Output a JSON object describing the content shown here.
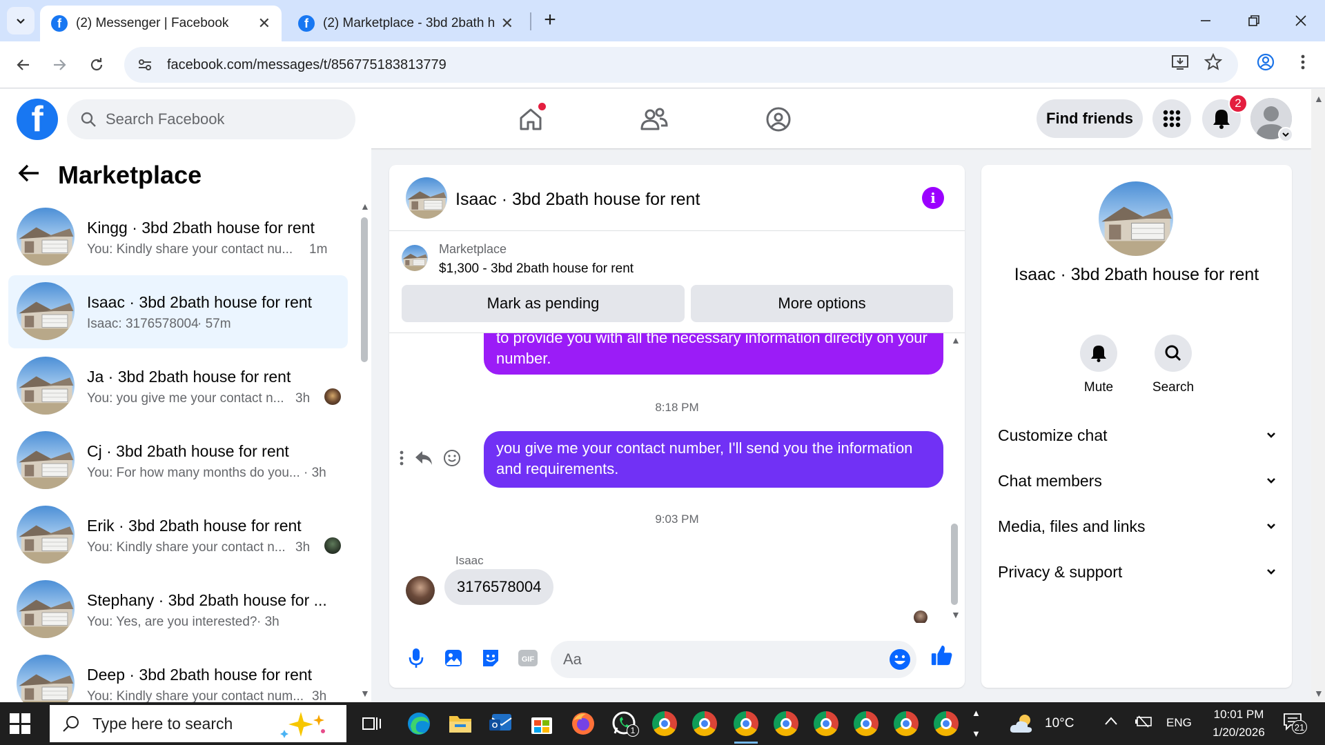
{
  "browser": {
    "tabs": [
      {
        "title": "(2) Messenger | Facebook",
        "active": true
      },
      {
        "title": "(2) Marketplace - 3bd 2bath house for rent",
        "active": false
      }
    ],
    "url": "facebook.com/messages/t/856775183813779"
  },
  "header": {
    "logo": "f",
    "search_placeholder": "Search Facebook",
    "find_friends_label": "Find friends",
    "notification_count": "2"
  },
  "sidebar": {
    "title": "Marketplace",
    "conversations": [
      {
        "name": "Kingg · 3bd 2bath house for rent",
        "preview": "You: Kindly share your contact nu...",
        "time": "1m"
      },
      {
        "name": "Isaac · 3bd 2bath house for rent",
        "preview": "Isaac: 3176578004",
        "time": "· 57m"
      },
      {
        "name": "Ja · 3bd 2bath house for rent",
        "preview": "You: you give me your contact n...",
        "time": "3h"
      },
      {
        "name": "Cj · 3bd 2bath house for rent",
        "preview": "You: For how many months do you...",
        "time": "· 3h"
      },
      {
        "name": "Erik · 3bd 2bath house for rent",
        "preview": "You: Kindly share your contact n...",
        "time": "3h"
      },
      {
        "name": "Stephany · 3bd 2bath house for ...",
        "preview": "You: Yes, are you interested?",
        "time": "· 3h"
      },
      {
        "name": "Deep · 3bd 2bath house for rent",
        "preview": "You: Kindly share your contact num...",
        "time": "3h"
      }
    ]
  },
  "chat": {
    "title": "Isaac · 3bd 2bath house for rent",
    "listing_label": "Marketplace",
    "listing_price": "$1,300 - 3bd 2bath house for rent",
    "mark_pending_label": "Mark as pending",
    "more_options_label": "More options",
    "messages": {
      "sent_partial": "to provide you with all the necessary information directly on your number.",
      "time1": "8:18 PM",
      "sent_2": "you give me your contact number, I'll send you the information and requirements.",
      "time2": "9:03 PM",
      "received_sender": "Isaac",
      "received_text": "3176578004"
    },
    "composer_placeholder": "Aa"
  },
  "details": {
    "name": "Isaac · 3bd 2bath house for rent",
    "mute_label": "Mute",
    "search_label": "Search",
    "sections": [
      "Customize chat",
      "Chat members",
      "Media, files and links",
      "Privacy & support"
    ]
  },
  "taskbar": {
    "search_placeholder": "Type here to search",
    "whatsapp_badge": "1",
    "weather": "10°C",
    "language": "ENG",
    "time": "10:01 PM",
    "date": "1/20/2026",
    "notification_count": "21"
  },
  "colors": {
    "facebook_blue": "#1877f2",
    "bubble_purple_top": "#9b1cf7",
    "bubble_purple": "#7131f5",
    "selected_row": "#ebf5ff",
    "badge_red": "#e41e3f"
  }
}
